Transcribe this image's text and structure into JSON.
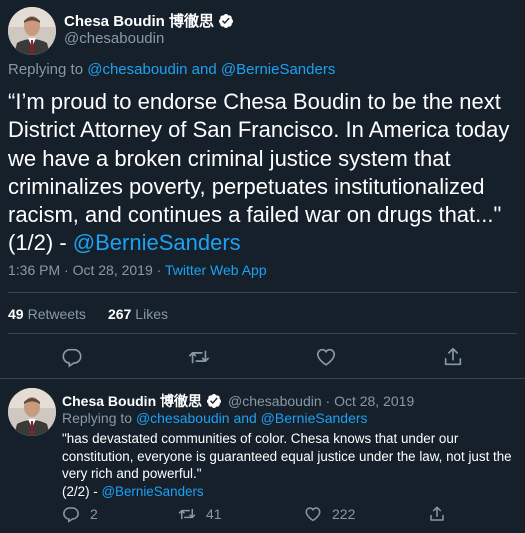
{
  "main_tweet": {
    "author_name": "Chesa Boudin 博徹思",
    "handle": "@chesaboudin",
    "replying_prefix": "Replying to",
    "replying_handles": "@chesaboudin and @BernieSanders",
    "text": "“I’m proud to endorse Chesa Boudin to be the next District Attorney of San Francisco. In America today we have a broken criminal justice system that criminalizes poverty, perpetuates institutionalized racism, and continues a failed war on drugs that...\" (1/2) - ",
    "text_mention": "@BernieSanders",
    "time": "1:36 PM · Oct 28, 2019 · ",
    "source": "Twitter Web App",
    "retweets_count": "49",
    "retweets_label": "Retweets",
    "likes_count": "267",
    "likes_label": "Likes"
  },
  "reply_tweet": {
    "author_name": "Chesa Boudin 博徹思",
    "handle_date": "@chesaboudin · Oct 28, 2019",
    "replying_prefix": "Replying to",
    "replying_handles": "@chesaboudin and @BernieSanders",
    "text": "\"has devastated communities of color. Chesa knows that under our constitution, everyone is guaranteed equal justice under the law, not just the very rich and powerful.\"",
    "signoff": "(2/2) - ",
    "signoff_mention": "@BernieSanders",
    "reply_count": "2",
    "retweet_count": "41",
    "like_count": "222"
  },
  "colors": {
    "background": "#15202b",
    "accent": "#1da1f2",
    "muted": "#8899a6",
    "divider": "#38444d"
  },
  "icons": [
    "verified-badge-icon",
    "reply-icon",
    "retweet-icon",
    "like-icon",
    "share-icon"
  ]
}
